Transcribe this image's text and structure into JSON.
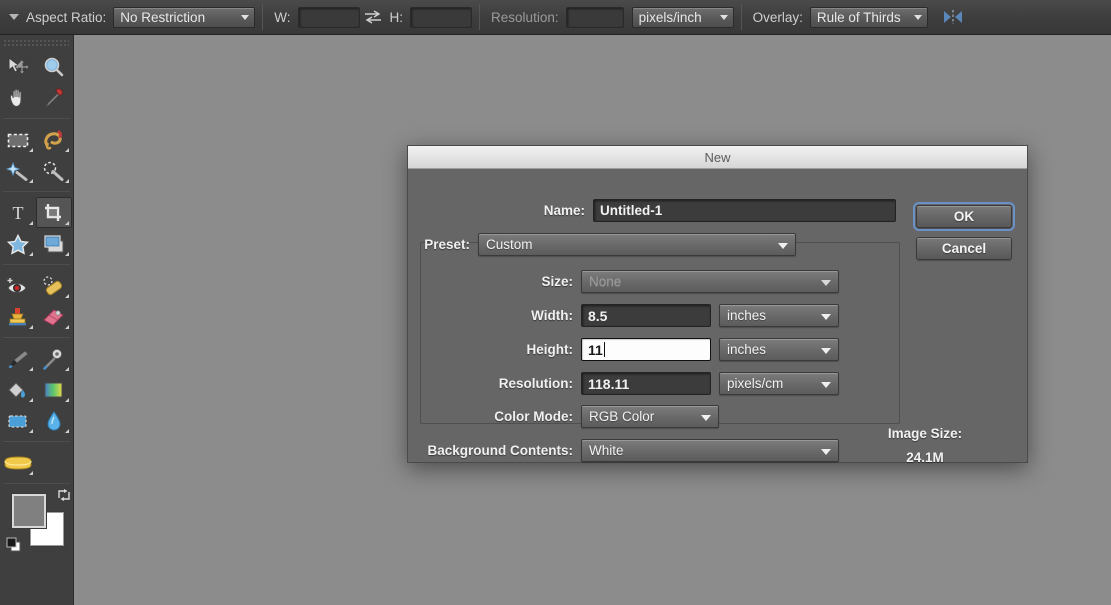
{
  "options_bar": {
    "menu_icon": "triangle-down-icon",
    "aspect_ratio_label": "Aspect Ratio:",
    "aspect_ratio_value": "No Restriction",
    "width_label": "W:",
    "width_value": "",
    "swap_icon": "swap-arrows-icon",
    "height_label": "H:",
    "height_value": "",
    "resolution_label": "Resolution:",
    "resolution_value": "",
    "resolution_unit": "pixels/inch",
    "overlay_label": "Overlay:",
    "overlay_value": "Rule of Thirds",
    "overlay_options_icon": "crop-sides-icon"
  },
  "toolbar": {
    "grip": "drag-grip",
    "tools": [
      {
        "name": "move-tool",
        "active": false,
        "has_submenu": false
      },
      {
        "name": "zoom-tool",
        "active": false,
        "has_submenu": false
      },
      {
        "name": "hand-tool",
        "active": false,
        "has_submenu": false
      },
      {
        "name": "eyedropper-tool",
        "active": false,
        "has_submenu": false
      },
      {
        "name": "rectangular-marquee-tool",
        "active": false,
        "has_submenu": true
      },
      {
        "name": "lasso-tool",
        "active": false,
        "has_submenu": true
      },
      {
        "name": "magic-wand-tool",
        "active": false,
        "has_submenu": true
      },
      {
        "name": "quick-selection-tool",
        "active": false,
        "has_submenu": true
      },
      {
        "name": "type-tool",
        "active": false,
        "has_submenu": true
      },
      {
        "name": "crop-tool",
        "active": true,
        "has_submenu": true
      },
      {
        "name": "shape-tool",
        "active": false,
        "has_submenu": true
      },
      {
        "name": "slice-tool",
        "active": false,
        "has_submenu": true
      },
      {
        "name": "red-eye-tool",
        "active": false,
        "has_submenu": false
      },
      {
        "name": "healing-brush-tool",
        "active": false,
        "has_submenu": true
      },
      {
        "name": "clone-stamp-tool",
        "active": false,
        "has_submenu": true
      },
      {
        "name": "eraser-tool",
        "active": false,
        "has_submenu": true
      },
      {
        "name": "brush-tool",
        "active": false,
        "has_submenu": true
      },
      {
        "name": "effects-brush-tool",
        "active": false,
        "has_submenu": true
      },
      {
        "name": "paint-bucket-tool",
        "active": false,
        "has_submenu": true
      },
      {
        "name": "gradient-tool",
        "active": false,
        "has_submenu": true
      },
      {
        "name": "blur-tool",
        "active": false,
        "has_submenu": true
      },
      {
        "name": "smudge-tool",
        "active": false,
        "has_submenu": true
      },
      {
        "name": "sponge-tool",
        "active": false,
        "has_submenu": true
      }
    ],
    "foreground_color": "#808080",
    "background_color": "#ffffff",
    "swap_colors_icon": "swap-colors-icon",
    "default_colors_icon": "default-colors-icon"
  },
  "dialog": {
    "title": "New",
    "name_label": "Name:",
    "name_value": "Untitled-1",
    "preset_label": "Preset:",
    "preset_value": "Custom",
    "size_label": "Size:",
    "size_value": "None",
    "width_label": "Width:",
    "width_value": "8.5",
    "width_unit": "inches",
    "height_label": "Height:",
    "height_value": "11",
    "height_unit": "inches",
    "resolution_label": "Resolution:",
    "resolution_value": "118.11",
    "resolution_unit": "pixels/cm",
    "color_mode_label": "Color Mode:",
    "color_mode_value": "RGB Color",
    "background_contents_label": "Background Contents:",
    "background_contents_value": "White",
    "image_size_label": "Image Size:",
    "image_size_value": "24.1M",
    "ok_label": "OK",
    "cancel_label": "Cancel"
  },
  "colors": {
    "canvas": "#8c8c8c",
    "dialog_body": "#666666",
    "toolbar": "#3f3f3f",
    "focus_ring": "#6a90c8"
  }
}
